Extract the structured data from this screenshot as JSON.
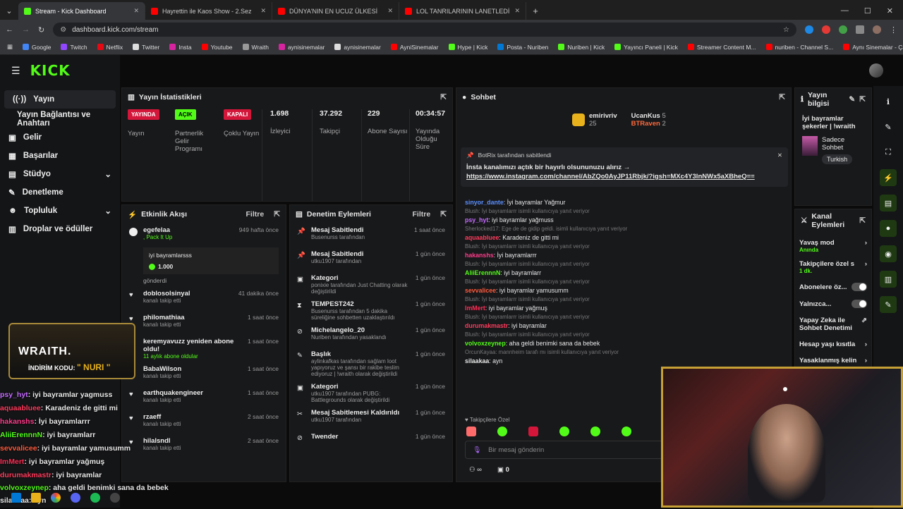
{
  "browser": {
    "tabs": [
      {
        "label": "Stream - Kick Dashboard",
        "color": "#53fc18"
      },
      {
        "label": "Hayrettin ile Kaos Show - 2.Sez",
        "color": "#ff0000"
      },
      {
        "label": "DÜNYA'NIN EN UCUZ ÜLKESİ",
        "color": "#ff0000"
      },
      {
        "label": "LOL TANRILARININ LANETLEDİ",
        "color": "#ff0000"
      }
    ],
    "url": "dashboard.kick.com/stream",
    "bookmarks": [
      "Google",
      "Twitch",
      "Netflix",
      "Twitter",
      "Insta",
      "Youtube",
      "Wraith",
      "aynisinemalar",
      "aynisinemalar",
      "AyniSinemalar",
      "Hype | Kick",
      "Posta - Nuriben",
      "Nuriben | Kick",
      "Yayıncı Paneli | Kick",
      "Streamer Content M...",
      "nuriben - Channel S...",
      "Aynı Sinemalar - Ça..."
    ]
  },
  "logo": "KICK",
  "sidebar": {
    "items": [
      {
        "label": "Yayın",
        "icon": "broadcast-icon"
      },
      {
        "label": "Yayın Bağlantısı ve Anahtarı",
        "icon": ""
      },
      {
        "label": "Gelir",
        "icon": "money-icon"
      },
      {
        "label": "Başarılar",
        "icon": "trophy-icon"
      },
      {
        "label": "Stüdyo",
        "icon": "studio-icon"
      },
      {
        "label": "Denetleme",
        "icon": "wrench-icon"
      },
      {
        "label": "Topluluk",
        "icon": "people-icon"
      },
      {
        "label": "Droplar ve ödüller",
        "icon": "gift-icon"
      }
    ]
  },
  "stats": {
    "title": "Yayın İstatistikleri",
    "live_badge": "YAYINDA",
    "live_label": "Yayın",
    "partner_badge": "AÇIK",
    "partner_label": "Partnerlik Gelir Programı",
    "multi_badge": "KAPALI",
    "multi_label": "Çoklu Yayın",
    "viewers": "1.698",
    "viewers_label": "İzleyici",
    "followers": "37.292",
    "followers_label": "Takipçi",
    "subs": "229",
    "subs_label": "Abone Sayısı",
    "uptime": "00:34:57",
    "uptime_label": "Yayında Olduğu Süre"
  },
  "activity": {
    "title": "Etkinlik Akışı",
    "filter": "Filtre",
    "items": [
      {
        "name": "egefelaa",
        "sub": ", Pack It Up",
        "time": "949 hafta önce"
      },
      {
        "name": "doblosolsinyal",
        "sub": "kanalı takip etti",
        "time": "41 dakika önce"
      },
      {
        "name": "philomathiaa",
        "sub": "kanalı takip etti",
        "time": "1 saat önce"
      },
      {
        "name": "keremyavuzz yeniden abone oldu!",
        "sub": "11 aylık abone oldular",
        "time": "1 saat önce"
      },
      {
        "name": "BabaWilson",
        "sub": "kanalı takip etti",
        "time": "1 saat önce"
      },
      {
        "name": "earthquakengineer",
        "sub": "kanalı takip etti",
        "time": "1 saat önce"
      },
      {
        "name": "rzaeff",
        "sub": "kanalı takip etti",
        "time": "2 saat önce"
      },
      {
        "name": "hilalsndl",
        "sub": "kanalı takip etti",
        "time": "2 saat önce"
      }
    ],
    "gift_msg": "iyi bayramlarsss",
    "gift_amount": "1.000",
    "gift_sent": "gönderdi"
  },
  "modlog": {
    "title": "Denetim Eylemleri",
    "filter": "Filtre",
    "items": [
      {
        "name": "Mesaj Sabitlendi",
        "sub": "Busenurss tarafından",
        "time": "1 saat önce"
      },
      {
        "name": "Mesaj Sabitlendi",
        "sub": "utku1907 tarafından",
        "time": "1 gün önce"
      },
      {
        "name": "Kategori",
        "sub": "ponixie tarafından Just Chatting olarak değiştirildi",
        "time": "1 gün önce"
      },
      {
        "name": "TEMPEST242",
        "sub": "Busenurss tarafından 5 dakika süreliğine sohbetten uzaklaştırıldı",
        "time": "1 gün önce"
      },
      {
        "name": "Michelangelo_20",
        "sub": "Nuriben tarafından yasaklandı",
        "time": "1 gün önce"
      },
      {
        "name": "Başlık",
        "sub": "aylinkafkas tarafından sağlam loot yapıyoruz ve şansı bir rakibe teslim ediyoruz | !wraith olarak değiştirildi",
        "time": "1 gün önce"
      },
      {
        "name": "Kategori",
        "sub": "utku1907 tarafından PUBG: Battlegrounds olarak değiştirildi",
        "time": "1 gün önce"
      },
      {
        "name": "Mesaj Sabitlemesi Kaldırıldı",
        "sub": "utku1907 tarafından",
        "time": "1 gün önce"
      },
      {
        "name": "Twender",
        "sub": "",
        "time": "1 gün önce"
      }
    ]
  },
  "chat": {
    "title": "Sohbet",
    "top": [
      {
        "name": "emirivriv",
        "val": "25"
      },
      {
        "name": "UcanKus",
        "val": "5"
      },
      {
        "name": "BTRaven",
        "val": "2"
      }
    ],
    "pinned_by": "BotRix tarafından sabitlendi",
    "pinned_text": "İnsta kanalımızı açtık bir hayırlı olsununuzu alırız →",
    "pinned_link": "https://www.instagram.com/channel/AbZQo0AyJP11Rbjk/?igsh=MXc4Y3lnNWx5aXBheQ==",
    "messages": [
      {
        "reply": "",
        "user": "sinyor_dante",
        "color": "#5b8fff",
        "text": "İyi bayramlar Yağmur"
      },
      {
        "reply": "Blush: İyi bayramlarrr isimli kullanıcıya yanıt veriyor",
        "user": "psy_hyt",
        "color": "#c56bff",
        "text": "iyi bayramlar yağmuss"
      },
      {
        "reply": "Sherlocked17: Ege de de gidip geldi. isimli kullanıcıya yanıt veriyor",
        "user": "aquaabluee",
        "color": "#ff3b5c",
        "text": "Karadeniz de gitti mi"
      },
      {
        "reply": "Blush: İyi bayramlarrr isimli kullanıcıya yanıt veriyor",
        "user": "hakanshs",
        "color": "#ff3b8a",
        "text": "İyi bayramlarrr"
      },
      {
        "reply": "Blush: İyi bayramlarrr isimli kullanıcıya yanıt veriyor",
        "user": "AliiErennnN",
        "color": "#53fc18",
        "text": "iyi bayramlarr"
      },
      {
        "reply": "Blush: İyi bayramlarrr isimli kullanıcıya yanıt veriyor",
        "user": "sevvalicee",
        "color": "#ff5a3c",
        "text": "iyi bayramlar yamusumm"
      },
      {
        "reply": "Blush: İyi bayramlarrr isimli kullanıcıya yanıt veriyor",
        "user": "ImMert",
        "color": "#ff2d55",
        "text": "iyi bayramlar yağmuş"
      },
      {
        "reply": "Blush: İyi bayramlarrr isimli kullanıcıya yanıt veriyor",
        "user": "durumakmastr",
        "color": "#ff3b5c",
        "text": "iyi bayramlar"
      },
      {
        "reply": "Blush: İyi bayramlarrr isimli kullanıcıya yanıt veriyor",
        "user": "volvoxzeynep",
        "color": "#53fc18",
        "text": "aha geldi benimki sana da bebek"
      },
      {
        "reply": "OrcunKayaa: mannheim tarafı mı isimli kullanıcıya yanıt veriyor",
        "user": "silaakaa",
        "color": "#e8e8e8",
        "text": "ayn"
      }
    ],
    "followers_only": "Takipçilere Özel",
    "input_placeholder": "Bir mesaj gönderin",
    "points": "0"
  },
  "info": {
    "title": "Yayın bilgisi",
    "stream_title": "İyi bayramlar şekerler | !wraith",
    "category": "Sadece Sohbet",
    "language": "Turkish"
  },
  "channel_actions": {
    "title": "Kanal Eylemleri",
    "slow_mode": "Yavaş mod",
    "slow_sub": "Anında",
    "followers_only": "Takipçilere özel s",
    "followers_sub": "1 dk.",
    "subs_only": "Abonelere öz...",
    "emotes_only": "Yalnızca...",
    "ai_mod": "Yapay Zeka ile Sohbet Denetimi",
    "age_restrict": "Hesap yaşı kısıtla",
    "banned": "Yasaklanmış kelin"
  },
  "overlay": {
    "brand": "WRAITH.",
    "promo": "İNDİRİM KODU:",
    "code": "\" NURI \"",
    "lines": [
      {
        "user": "psy_hyt",
        "color": "#c56bff",
        "text": ": iyi bayramlar yagmuss"
      },
      {
        "user": "aquaabluee",
        "color": "#ff3b5c",
        "text": ": Karadeniz de gitti mi"
      },
      {
        "user": "hakanshs",
        "color": "#ff3b8a",
        "text": ": İyi bayramlarrr"
      },
      {
        "user": "AliiErennnN",
        "color": "#53fc18",
        "text": ": iyi bayramlarr"
      },
      {
        "user": "sevvalicee",
        "color": "#ff5a3c",
        "text": ": iyi bayramlar yamusumm"
      },
      {
        "user": "ImMert",
        "color": "#ff2d55",
        "text": ": iyi bayramlar yağmuş"
      },
      {
        "user": "durumakmastr",
        "color": "#ff3b5c",
        "text": ": iyi bayramlar"
      },
      {
        "user": "volvoxzeynep",
        "color": "#53fc18",
        "text": ": aha geldi benimki sana da bebek"
      },
      {
        "user": "silaakaa",
        "color": "#e8e8e8",
        "text": ": ayn"
      }
    ]
  },
  "accent": "#53fc18"
}
